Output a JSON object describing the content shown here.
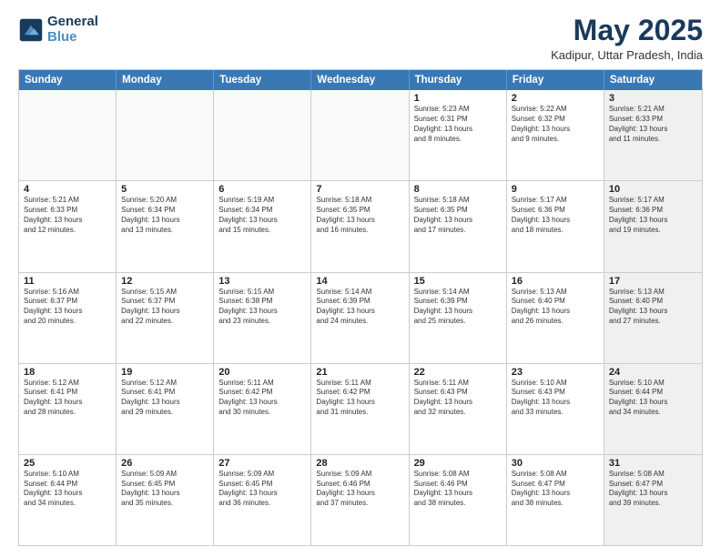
{
  "logo": {
    "line1": "General",
    "line2": "Blue"
  },
  "title": "May 2025",
  "location": "Kadipur, Uttar Pradesh, India",
  "weekdays": [
    "Sunday",
    "Monday",
    "Tuesday",
    "Wednesday",
    "Thursday",
    "Friday",
    "Saturday"
  ],
  "rows": [
    [
      {
        "day": "",
        "text": "",
        "empty": true
      },
      {
        "day": "",
        "text": "",
        "empty": true
      },
      {
        "day": "",
        "text": "",
        "empty": true
      },
      {
        "day": "",
        "text": "",
        "empty": true
      },
      {
        "day": "1",
        "text": "Sunrise: 5:23 AM\nSunset: 6:31 PM\nDaylight: 13 hours\nand 8 minutes."
      },
      {
        "day": "2",
        "text": "Sunrise: 5:22 AM\nSunset: 6:32 PM\nDaylight: 13 hours\nand 9 minutes."
      },
      {
        "day": "3",
        "text": "Sunrise: 5:21 AM\nSunset: 6:33 PM\nDaylight: 13 hours\nand 11 minutes.",
        "shaded": true
      }
    ],
    [
      {
        "day": "4",
        "text": "Sunrise: 5:21 AM\nSunset: 6:33 PM\nDaylight: 13 hours\nand 12 minutes."
      },
      {
        "day": "5",
        "text": "Sunrise: 5:20 AM\nSunset: 6:34 PM\nDaylight: 13 hours\nand 13 minutes."
      },
      {
        "day": "6",
        "text": "Sunrise: 5:19 AM\nSunset: 6:34 PM\nDaylight: 13 hours\nand 15 minutes."
      },
      {
        "day": "7",
        "text": "Sunrise: 5:18 AM\nSunset: 6:35 PM\nDaylight: 13 hours\nand 16 minutes."
      },
      {
        "day": "8",
        "text": "Sunrise: 5:18 AM\nSunset: 6:35 PM\nDaylight: 13 hours\nand 17 minutes."
      },
      {
        "day": "9",
        "text": "Sunrise: 5:17 AM\nSunset: 6:36 PM\nDaylight: 13 hours\nand 18 minutes."
      },
      {
        "day": "10",
        "text": "Sunrise: 5:17 AM\nSunset: 6:36 PM\nDaylight: 13 hours\nand 19 minutes.",
        "shaded": true
      }
    ],
    [
      {
        "day": "11",
        "text": "Sunrise: 5:16 AM\nSunset: 6:37 PM\nDaylight: 13 hours\nand 20 minutes."
      },
      {
        "day": "12",
        "text": "Sunrise: 5:15 AM\nSunset: 6:37 PM\nDaylight: 13 hours\nand 22 minutes."
      },
      {
        "day": "13",
        "text": "Sunrise: 5:15 AM\nSunset: 6:38 PM\nDaylight: 13 hours\nand 23 minutes."
      },
      {
        "day": "14",
        "text": "Sunrise: 5:14 AM\nSunset: 6:39 PM\nDaylight: 13 hours\nand 24 minutes."
      },
      {
        "day": "15",
        "text": "Sunrise: 5:14 AM\nSunset: 6:39 PM\nDaylight: 13 hours\nand 25 minutes."
      },
      {
        "day": "16",
        "text": "Sunrise: 5:13 AM\nSunset: 6:40 PM\nDaylight: 13 hours\nand 26 minutes."
      },
      {
        "day": "17",
        "text": "Sunrise: 5:13 AM\nSunset: 6:40 PM\nDaylight: 13 hours\nand 27 minutes.",
        "shaded": true
      }
    ],
    [
      {
        "day": "18",
        "text": "Sunrise: 5:12 AM\nSunset: 6:41 PM\nDaylight: 13 hours\nand 28 minutes."
      },
      {
        "day": "19",
        "text": "Sunrise: 5:12 AM\nSunset: 6:41 PM\nDaylight: 13 hours\nand 29 minutes."
      },
      {
        "day": "20",
        "text": "Sunrise: 5:11 AM\nSunset: 6:42 PM\nDaylight: 13 hours\nand 30 minutes."
      },
      {
        "day": "21",
        "text": "Sunrise: 5:11 AM\nSunset: 6:42 PM\nDaylight: 13 hours\nand 31 minutes."
      },
      {
        "day": "22",
        "text": "Sunrise: 5:11 AM\nSunset: 6:43 PM\nDaylight: 13 hours\nand 32 minutes."
      },
      {
        "day": "23",
        "text": "Sunrise: 5:10 AM\nSunset: 6:43 PM\nDaylight: 13 hours\nand 33 minutes."
      },
      {
        "day": "24",
        "text": "Sunrise: 5:10 AM\nSunset: 6:44 PM\nDaylight: 13 hours\nand 34 minutes.",
        "shaded": true
      }
    ],
    [
      {
        "day": "25",
        "text": "Sunrise: 5:10 AM\nSunset: 6:44 PM\nDaylight: 13 hours\nand 34 minutes."
      },
      {
        "day": "26",
        "text": "Sunrise: 5:09 AM\nSunset: 6:45 PM\nDaylight: 13 hours\nand 35 minutes."
      },
      {
        "day": "27",
        "text": "Sunrise: 5:09 AM\nSunset: 6:45 PM\nDaylight: 13 hours\nand 36 minutes."
      },
      {
        "day": "28",
        "text": "Sunrise: 5:09 AM\nSunset: 6:46 PM\nDaylight: 13 hours\nand 37 minutes."
      },
      {
        "day": "29",
        "text": "Sunrise: 5:08 AM\nSunset: 6:46 PM\nDaylight: 13 hours\nand 38 minutes."
      },
      {
        "day": "30",
        "text": "Sunrise: 5:08 AM\nSunset: 6:47 PM\nDaylight: 13 hours\nand 38 minutes."
      },
      {
        "day": "31",
        "text": "Sunrise: 5:08 AM\nSunset: 6:47 PM\nDaylight: 13 hours\nand 39 minutes.",
        "shaded": true
      }
    ]
  ]
}
